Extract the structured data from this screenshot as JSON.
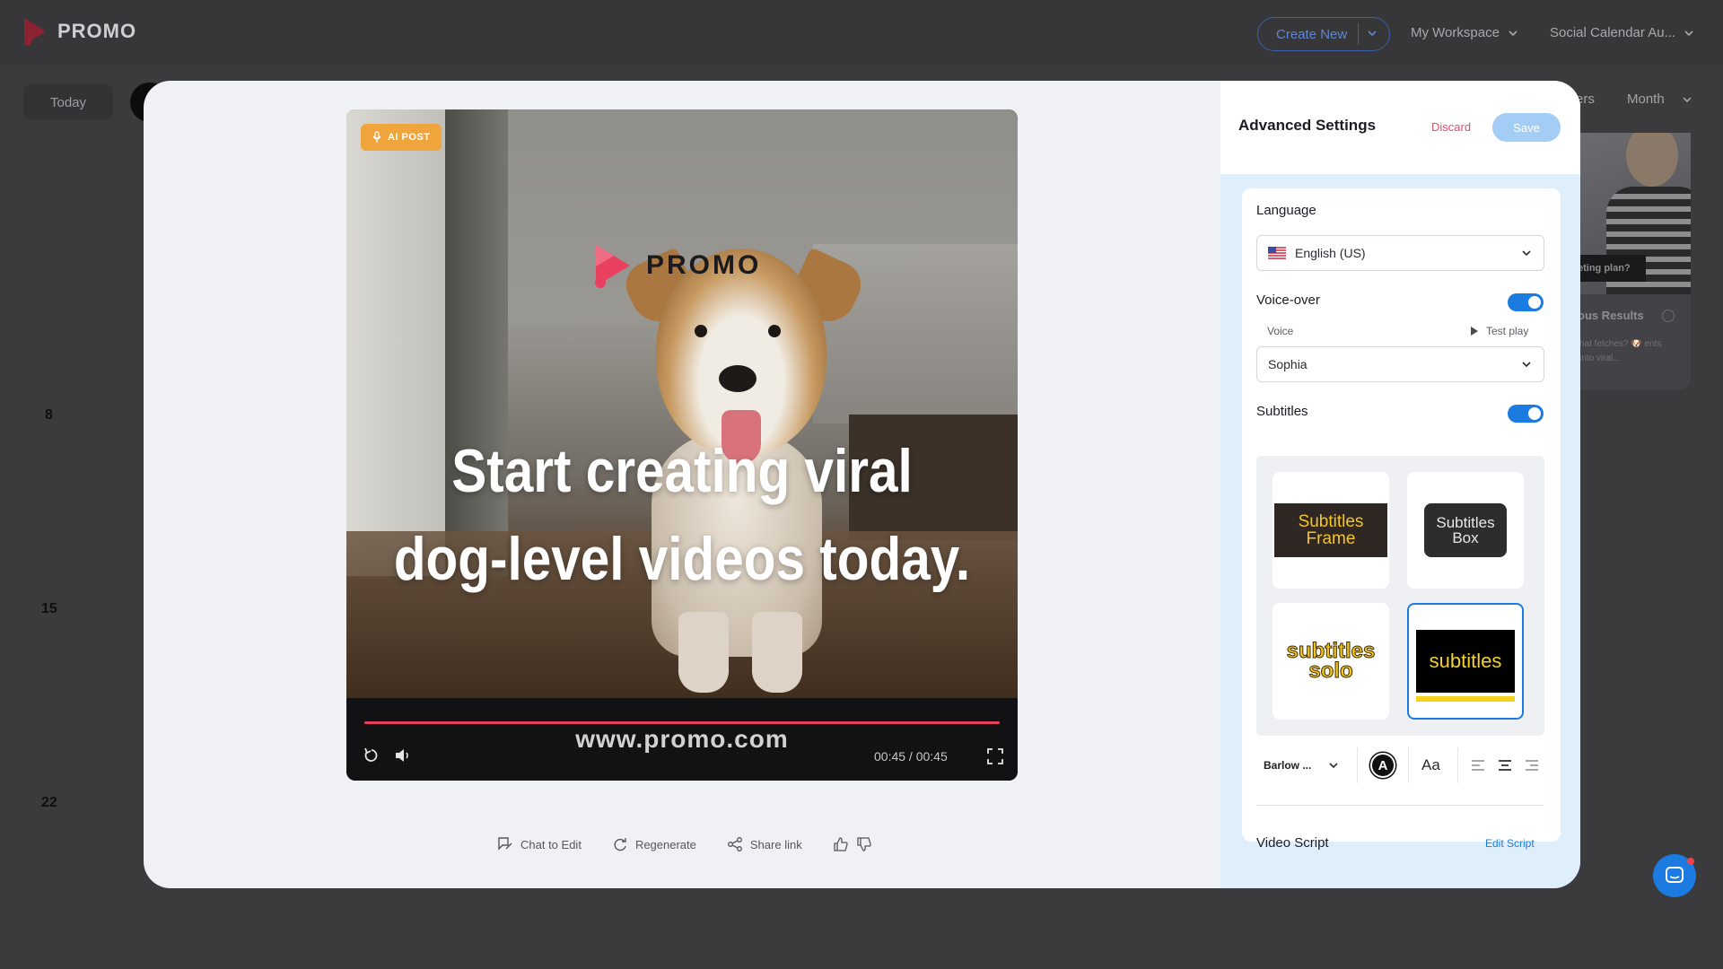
{
  "app": {
    "logo_text": "PROMO",
    "brand_color": "#e8405e"
  },
  "topbar": {
    "create_new": "Create New",
    "workspace": "My Workspace",
    "calendar": "Social Calendar Au..."
  },
  "calendar": {
    "today": "Today",
    "filters_fragment": "ers",
    "view": "Month",
    "day_numbers": [
      "8",
      "15",
      "22"
    ],
    "bg_post": {
      "pill": "eting plan?",
      "title": "ous Results",
      "text": "hat fetches? 🐶 ents into viral..."
    }
  },
  "video": {
    "badge": "AI POST",
    "logo_text": "PROMO",
    "headline_line1": "Start creating viral",
    "headline_line2": "dog-level videos today.",
    "url": "www.promo.com",
    "time": "00:45 / 00:45",
    "progress": 1.0
  },
  "actions": {
    "chat": "Chat to Edit",
    "regenerate": "Regenerate",
    "share": "Share link"
  },
  "panel": {
    "title": "Advanced Settings",
    "discard": "Discard",
    "save": "Save",
    "language_label": "Language",
    "language_value": "English (US)",
    "voiceover_label": "Voice-over",
    "voiceover_on": true,
    "voice_label": "Voice",
    "test_play": "Test play",
    "voice_value": "Sophia",
    "subtitles_label": "Subtitles",
    "subtitles_on": true,
    "styles": {
      "frame_line1": "Subtitles",
      "frame_line2": "Frame",
      "box_line1": "Subtitles",
      "box_line2": "Box",
      "solo_line1": "subtitles",
      "solo_line2": "solo",
      "underline": "subtitles"
    },
    "font_value": "Barlow ...",
    "color_glyph": "A",
    "case_glyph": "Aa",
    "video_script_label": "Video Script",
    "edit_script": "Edit Script"
  }
}
